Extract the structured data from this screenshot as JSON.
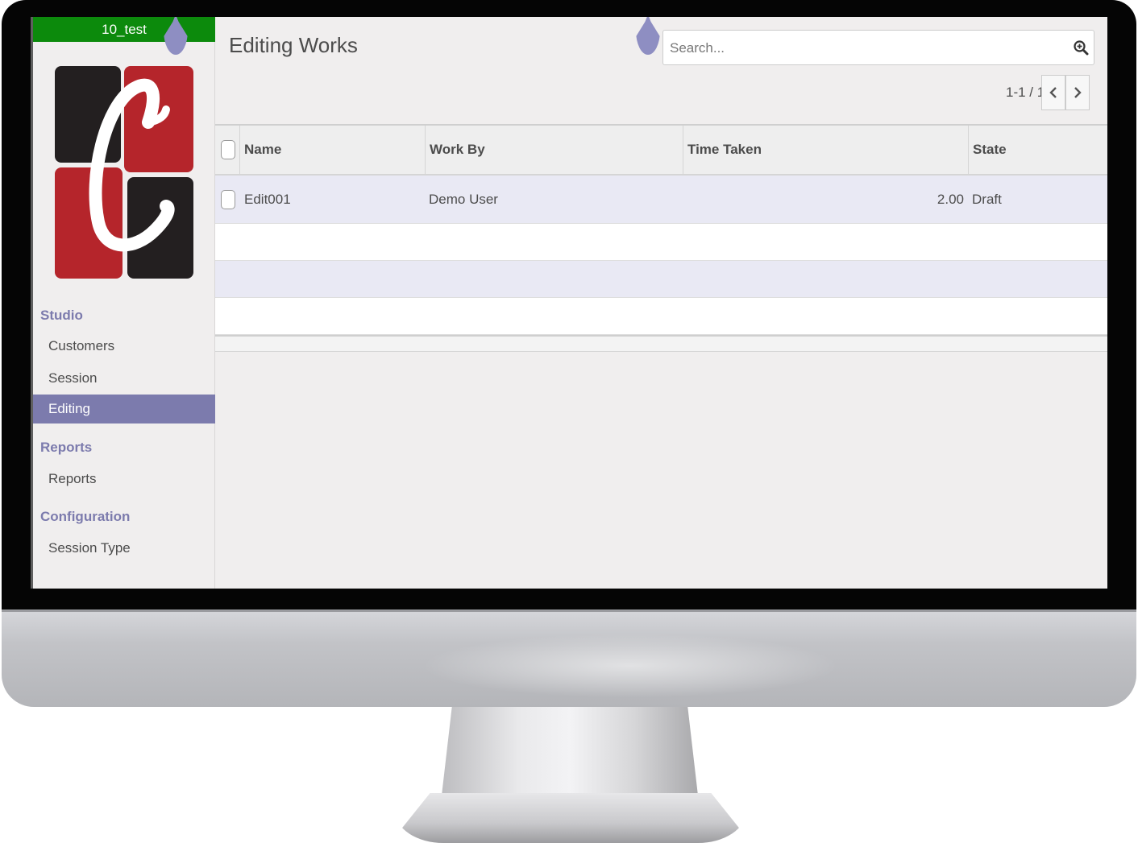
{
  "app": {
    "database_name": "10_test"
  },
  "sidebar": {
    "sections": [
      {
        "heading": "Studio",
        "items": [
          "Customers",
          "Session",
          "Editing"
        ]
      },
      {
        "heading": "Reports",
        "items": [
          "Reports"
        ]
      },
      {
        "heading": "Configuration",
        "items": [
          "Session Type"
        ]
      }
    ],
    "active_item": "Editing"
  },
  "main": {
    "title": "Editing Works",
    "search": {
      "placeholder": "Search...",
      "value": ""
    },
    "pager": {
      "value": "1-1 / 1"
    },
    "table": {
      "columns": [
        "Name",
        "Work By",
        "Time Taken",
        "State"
      ],
      "rows": [
        {
          "name": "Edit001",
          "work_by": "Demo User",
          "time_taken": "2.00",
          "state": "Draft"
        }
      ]
    }
  },
  "colors": {
    "db_bar": "#0c8a0c",
    "accent": "#7c7bad",
    "logo_red": "#b5252b",
    "logo_dark": "#231f20"
  },
  "icons": [
    "search-icon",
    "chevron-left-icon",
    "chevron-right-icon"
  ]
}
